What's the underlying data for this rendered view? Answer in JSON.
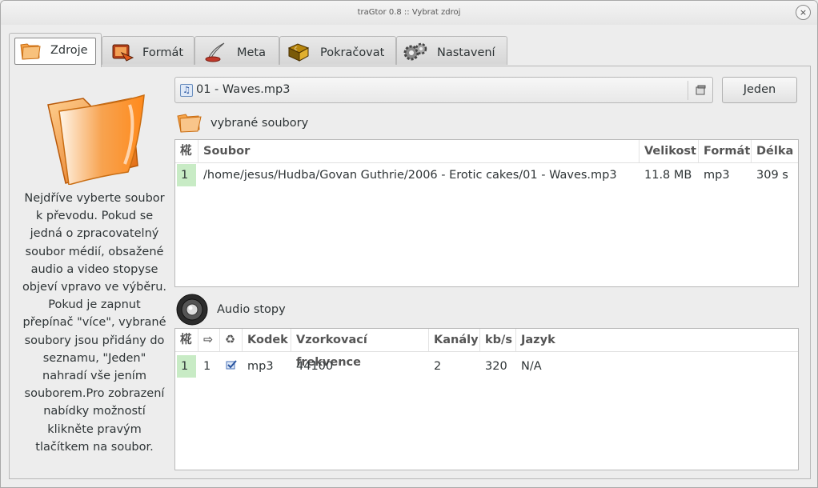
{
  "window": {
    "title": "traGtor 0.8 :: Vybrat zdroj",
    "close_glyph": "×"
  },
  "tabs": [
    {
      "label": "Zdroje",
      "icon": "folder-icon",
      "active": true
    },
    {
      "label": "Formát",
      "icon": "film-icon",
      "active": false
    },
    {
      "label": "Meta",
      "icon": "quill-icon",
      "active": false
    },
    {
      "label": "Pokračovat",
      "icon": "terminal-icon",
      "active": false
    },
    {
      "label": "Nastavení",
      "icon": "gears-icon",
      "active": false
    }
  ],
  "sidebar": {
    "help_lines": [
      "Nejdříve vyberte soubor",
      "k převodu. Pokud se",
      "jedná o zpracovatelný",
      "soubor médií, obsažené",
      "audio a video stopyse",
      "objeví vpravo ve výběru.",
      "Pokud je zapnut",
      "přepínač \"více\", vybrané",
      "soubory jsou přidány do",
      "seznamu, \"Jeden\"",
      "nahradí vše jením",
      "souborem.Pro zobrazení",
      "nabídky možností",
      "klikněte pravým",
      "tlačítkem na soubor."
    ]
  },
  "source": {
    "file_value": "01 - Waves.mp3",
    "jeden_label": "Jeden"
  },
  "files_section": {
    "heading": "vybrané soubory",
    "columns": [
      "椛",
      "Soubor",
      "Velikost",
      "Formát",
      "Délka"
    ],
    "rows": [
      {
        "idx": "1",
        "path": "/home/jesus/Hudba/Govan Guthrie/2006 - Erotic cakes/01 - Waves.mp3",
        "size": "11.8 MB",
        "format": "mp3",
        "length": "309 s"
      }
    ]
  },
  "audio_section": {
    "heading": "Audio stopy",
    "columns": [
      "椛",
      "⇨",
      "♻",
      "Kodek",
      "Vzorkovací frekvence",
      "Kanály",
      "kb/s",
      "Jazyk"
    ],
    "rows": [
      {
        "idx": "1",
        "track": "1",
        "checked": true,
        "codec": "mp3",
        "rate": "44100",
        "channels": "2",
        "kbps": "320",
        "lang": "N/A"
      }
    ]
  },
  "colors": {
    "accent_orange": "#f08a1c",
    "index_green": "#c8ebc5",
    "border": "#b8b8b8"
  }
}
